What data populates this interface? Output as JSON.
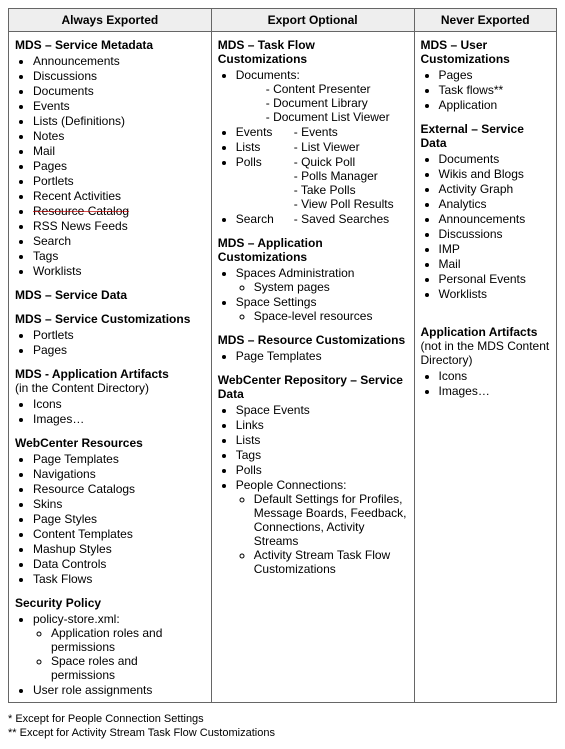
{
  "headers": [
    "Always Exported",
    "Export Optional",
    "Never Exported"
  ],
  "col1": {
    "s1": {
      "title": "MDS – Service Metadata",
      "items": [
        "Announcements",
        "Discussions",
        "Documents",
        "Events",
        "Lists (Definitions)",
        "Notes",
        "Mail",
        "Pages",
        "Portlets",
        "Recent Activities",
        "Resource Catalog",
        "RSS News Feeds",
        "Search",
        "Tags",
        "Worklists"
      ]
    },
    "s2": {
      "title": "MDS – Service Data"
    },
    "s3": {
      "title": "MDS – Service Customizations",
      "items": [
        "Portlets",
        "Pages"
      ]
    },
    "s4": {
      "title": "MDS - Application  Artifacts",
      "sub": "(in the Content Directory)",
      "items": [
        "Icons",
        "Images…"
      ]
    },
    "s5": {
      "title": "WebCenter Resources",
      "items": [
        "Page Templates",
        "Navigations",
        "Resource Catalogs",
        "Skins",
        "Page Styles",
        "Content Templates",
        "Mashup Styles",
        "Data Controls",
        "Task Flows"
      ]
    },
    "s6": {
      "title": "Security Policy",
      "item1": "policy-store.xml:",
      "sub1": [
        "Application roles and permissions",
        "Space roles and permissions"
      ],
      "item2": "User role assignments"
    }
  },
  "col2": {
    "s1": {
      "title": "MDS – Task Flow Customizations",
      "docLabel": "Documents:",
      "docSubs": [
        "Content Presenter",
        "Document Library",
        "Document List Viewer"
      ],
      "pairs": [
        {
          "l": "Events",
          "r": [
            "Events"
          ]
        },
        {
          "l": "Lists",
          "r": [
            "List Viewer"
          ]
        },
        {
          "l": "Polls",
          "r": [
            "Quick Poll",
            "Polls Manager",
            "Take Polls",
            "View Poll Results"
          ]
        },
        {
          "l": "Search",
          "r": [
            "Saved Searches"
          ]
        }
      ]
    },
    "s2": {
      "title": "MDS – Application Customizations",
      "i1": "Spaces Administration",
      "i1s": "System pages",
      "i2": "Space Settings",
      "i2s": "Space-level resources"
    },
    "s3": {
      "title": "MDS – Resource Customizations",
      "items": [
        "Page Templates"
      ]
    },
    "s4": {
      "title": "WebCenter Repository  – Service Data",
      "items": [
        "Space Events",
        "Links",
        "Lists",
        "Tags",
        "Polls"
      ],
      "pcLabel": "People Connections:",
      "pcSubs": [
        "Default Settings for Profiles, Message Boards, Feedback, Connections, Activity Streams",
        "Activity Stream Task Flow Customizations"
      ]
    }
  },
  "col3": {
    "s1": {
      "title": "MDS – User Customizations",
      "items": [
        "Pages",
        "Task flows**",
        "Application"
      ]
    },
    "s2": {
      "title": "External – Service Data",
      "items": [
        "Documents",
        "Wikis and Blogs",
        "Activity Graph",
        "Analytics",
        "Announcements",
        "Discussions",
        "IMP",
        "Mail",
        "Personal Events",
        "Worklists"
      ]
    },
    "s3": {
      "title": "Application Artifacts",
      "sub": "(not in the MDS Content Directory)",
      "items": [
        "Icons",
        "Images…"
      ]
    }
  },
  "footnotes": {
    "f1": "*  Except for People Connection Settings",
    "f2": "** Except for Activity Stream Task Flow Customizations"
  }
}
